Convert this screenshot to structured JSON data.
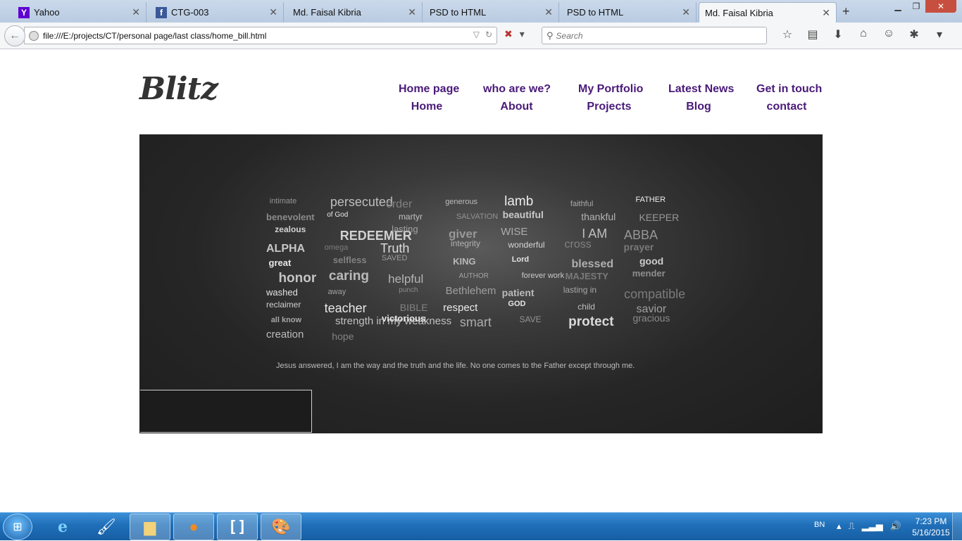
{
  "browser": {
    "tabs": [
      {
        "title": "Yahoo",
        "icon": "yahoo-icon"
      },
      {
        "title": "CTG-003",
        "icon": "facebook-icon"
      },
      {
        "title": "Md. Faisal Kibria",
        "icon": ""
      },
      {
        "title": "PSD to HTML",
        "icon": ""
      },
      {
        "title": "PSD to HTML",
        "icon": ""
      },
      {
        "title": "Md. Faisal Kibria",
        "icon": "",
        "active": true
      }
    ],
    "url": "file:///E:/projects/CT/personal page/last class/home_bill.html",
    "search_placeholder": "Search",
    "new_tab_label": "+"
  },
  "page": {
    "logo": "Blitz",
    "nav": [
      {
        "top": "Home page",
        "sub": "Home"
      },
      {
        "top": "who are we?",
        "sub": "About"
      },
      {
        "top": "My Portfolio",
        "sub": "Projects"
      },
      {
        "top": "Latest News",
        "sub": "Blog"
      },
      {
        "top": "Get in touch",
        "sub": "contact"
      }
    ],
    "hero": {
      "quote": "Jesus answered,    I am the way and the truth and the life. No one comes to the Father except through me.",
      "words": [
        "intimate",
        "persecuted",
        "order",
        "generous",
        "lamb",
        "faithful",
        "FATHER",
        "benevolent",
        "of God",
        "martyr",
        "SALVATION",
        "beautiful",
        "thankful",
        "KEEPER",
        "zealous",
        "REDEEMER",
        "lasting",
        "giver",
        "WISE",
        "I AM",
        "ABBA",
        "ALPHA",
        "omega",
        "Truth",
        "integrity",
        "wonderful",
        "cross",
        "prayer",
        "great",
        "selfless",
        "SAVED",
        "KING",
        "Lord",
        "blessed",
        "good",
        "honor",
        "caring",
        "helpful",
        "AUTHOR",
        "forever work",
        "MAJESTY",
        "mender",
        "washed",
        "away",
        "punch",
        "Bethlehem",
        "patient",
        "lasting in",
        "compatible",
        "reclaimer",
        "teacher",
        "BIBLE",
        "respect",
        "GOD",
        "child",
        "savior",
        "all know",
        "strength in my weakness",
        "victorious",
        "smart",
        "SAVE",
        "protect",
        "gracious",
        "creation",
        "hope"
      ]
    }
  },
  "taskbar": {
    "language": "BN",
    "time": "7:23 PM",
    "date": "5/16/2015"
  }
}
